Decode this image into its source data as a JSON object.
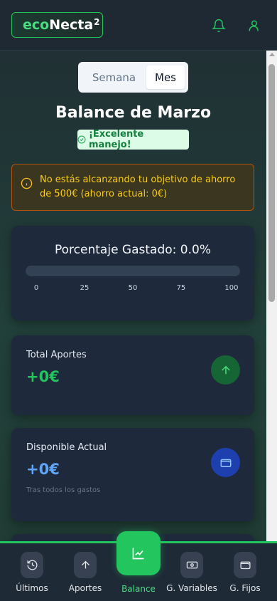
{
  "header": {
    "logo_eco": "eco",
    "logo_necta": "Necta",
    "logo_sup": "2",
    "icons": [
      "bell-icon",
      "user-icon"
    ]
  },
  "segmented": {
    "options": [
      "Semana",
      "Mes"
    ],
    "selected": "Mes"
  },
  "page": {
    "title": "Balance de Marzo",
    "badge": "¡Excelente manejo!"
  },
  "alert": {
    "text": "No estás alcanzando tu objetivo de ahorro de 500€ (ahorro actual: 0€)"
  },
  "percentage_card": {
    "title": "Porcentaje Gastado: 0.0%",
    "progress": 0.0,
    "ticks": [
      "0",
      "25",
      "50",
      "75",
      "100"
    ]
  },
  "total_aportes": {
    "label": "Total Aportes",
    "value": "+0€"
  },
  "disponible": {
    "label": "Disponible Actual",
    "value": "+0€",
    "sub": "Tras todos los gastos"
  },
  "nav": {
    "items": [
      {
        "label": "Últimos",
        "icon": "history-icon"
      },
      {
        "label": "Aportes",
        "icon": "arrow-up-icon"
      },
      {
        "label": "Balance",
        "icon": "chart-icon"
      },
      {
        "label": "G. Variables",
        "icon": "cash-icon"
      },
      {
        "label": "G. Fijos",
        "icon": "wallet-icon"
      }
    ],
    "active": "Balance"
  },
  "colors": {
    "accent": "#22c55e",
    "warning": "#facc15",
    "blue": "#60a5fa"
  }
}
